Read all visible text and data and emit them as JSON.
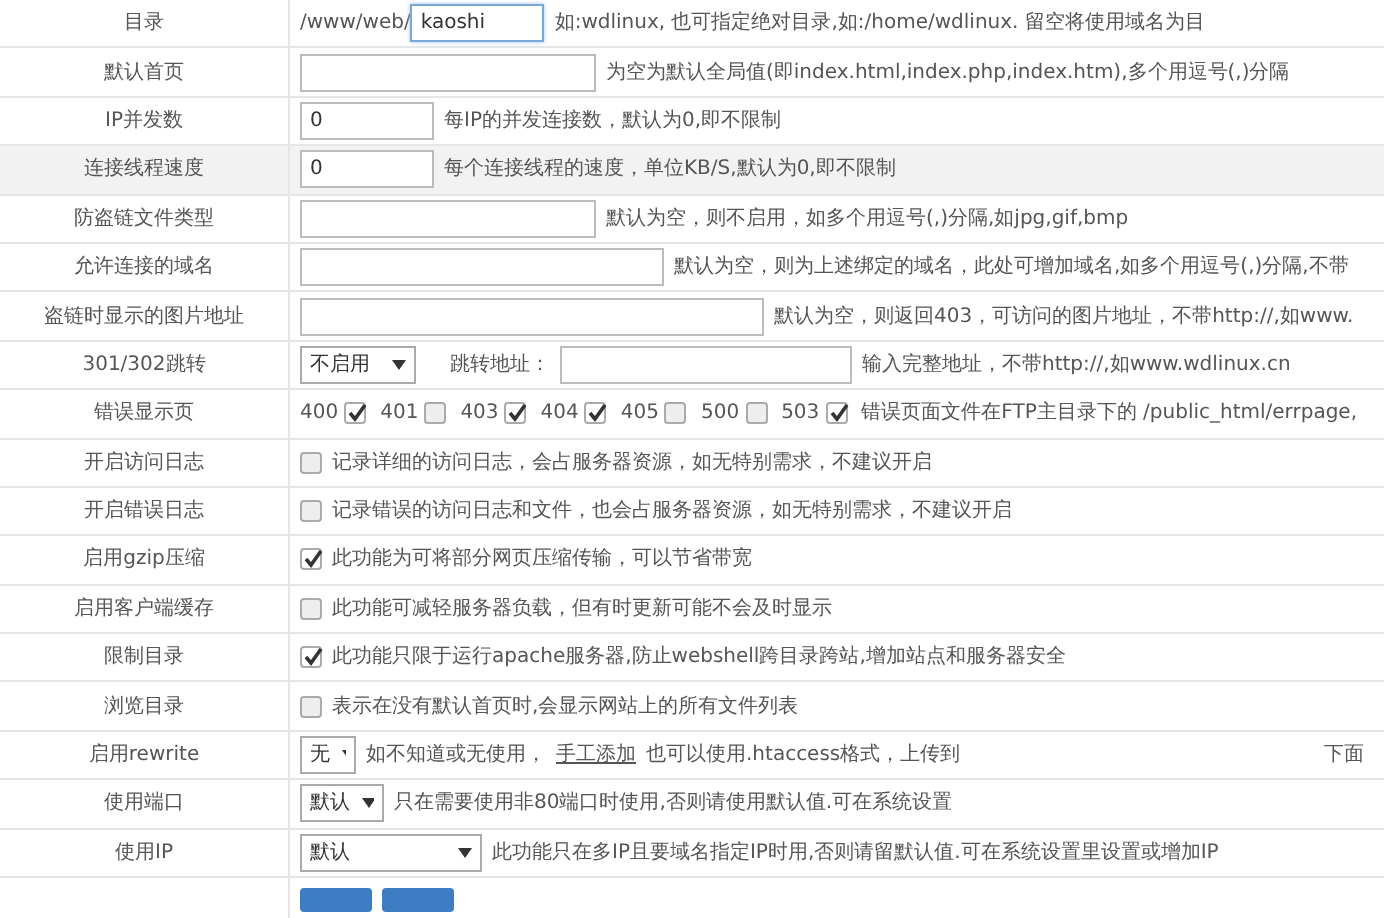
{
  "rows": [
    {
      "label": "目录",
      "kind": "prefix_input",
      "prefix": "/www/web/",
      "value": "kaoshi",
      "focused": true,
      "note": "如:wdlinux, 也可指定绝对目录,如:/home/wdlinux. 留空将使用域名为目"
    },
    {
      "label": "默认首页",
      "kind": "input",
      "value": "",
      "note": "为空为默认全局值(即index.html,index.php,index.htm),多个用逗号(,)分隔"
    },
    {
      "label": "IP并发数",
      "kind": "input",
      "value": "0",
      "note": "每IP的并发连接数，默认为0,即不限制"
    },
    {
      "label": "连接线程速度",
      "kind": "input",
      "value": "0",
      "highlighted": true,
      "note": "每个连接线程的速度，单位KB/S,默认为0,即不限制"
    },
    {
      "label": "防盗链文件类型",
      "kind": "input",
      "value": "",
      "note": "默认为空，则不启用，如多个用逗号(,)分隔,如jpg,gif,bmp"
    },
    {
      "label": "允许连接的域名",
      "kind": "input",
      "value": "",
      "note": "默认为空，则为上述绑定的域名，此处可增加域名,如多个用逗号(,)分隔,不带"
    },
    {
      "label": "盗链时显示的图片地址",
      "kind": "input",
      "value": "",
      "note": "默认为空，则返回403，可访问的图片地址，不带http://,如www."
    },
    {
      "label": "301/302跳转",
      "kind": "redirect",
      "select": "不启用",
      "target_label": "跳转地址：",
      "value": "",
      "note": "输入完整地址，不带http://,如www.wdlinux.cn"
    },
    {
      "label": "错误显示页",
      "kind": "codes",
      "codes": [
        {
          "code": "400",
          "checked": true
        },
        {
          "code": "401",
          "checked": false
        },
        {
          "code": "403",
          "checked": true
        },
        {
          "code": "404",
          "checked": true
        },
        {
          "code": "405",
          "checked": false
        },
        {
          "code": "500",
          "checked": false
        },
        {
          "code": "503",
          "checked": true
        }
      ],
      "note": "错误页面文件在FTP主目录下的 /public_html/errpage,"
    },
    {
      "label": "开启访问日志",
      "kind": "check",
      "checked": false,
      "note": "记录详细的访问日志，会占服务器资源，如无特别需求，不建议开启"
    },
    {
      "label": "开启错误日志",
      "kind": "check",
      "checked": false,
      "note": "记录错误的访问日志和文件，也会占服务器资源，如无特别需求，不建议开启"
    },
    {
      "label": "启用gzip压缩",
      "kind": "check",
      "checked": true,
      "note": "此功能为可将部分网页压缩传输，可以节省带宽"
    },
    {
      "label": "启用客户端缓存",
      "kind": "check",
      "checked": false,
      "note": "此功能可减轻服务器负载，但有时更新可能不会及时显示"
    },
    {
      "label": "限制目录",
      "kind": "check",
      "checked": true,
      "note": "此功能只限于运行apache服务器,防止webshell跨目录跨站,增加站点和服务器安全"
    },
    {
      "label": "浏览目录",
      "kind": "check",
      "checked": false,
      "note": "表示在没有默认首页时,会显示网站上的所有文件列表"
    },
    {
      "label": "启用rewrite",
      "kind": "rewrite",
      "select": "无",
      "note": "如不知道或无使用，",
      "link": "手工添加",
      "note2": "也可以使用.htaccess格式，上传到",
      "tail": "下面"
    },
    {
      "label": "使用端口",
      "kind": "select",
      "select": "默认",
      "note": "只在需要使用非80端口时使用,否则请使用默认值.可在系统设置"
    },
    {
      "label": "使用IP",
      "kind": "select",
      "select": "默认",
      "note": "此功能只在多IP且要域名指定IP时用,否则请留默认值.可在系统设置里设置或增加IP"
    },
    {
      "kind": "buttons",
      "buttons": [
        {
          "kind": "primary"
        },
        {
          "kind": "primary"
        }
      ]
    }
  ]
}
